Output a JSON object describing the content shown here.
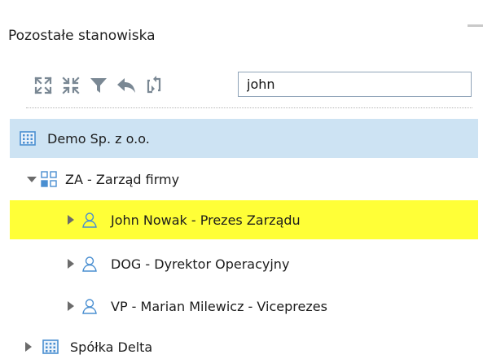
{
  "panel": {
    "title": "Pozostałe stanowiska"
  },
  "toolbar": {
    "buttons": [
      {
        "name": "expand-all",
        "icon": "expand-icon"
      },
      {
        "name": "collapse-all",
        "icon": "collapse-icon"
      },
      {
        "name": "filter",
        "icon": "filter-icon"
      },
      {
        "name": "back",
        "icon": "reply-arrow-icon"
      },
      {
        "name": "refresh",
        "icon": "refresh-icon"
      }
    ]
  },
  "search": {
    "value": "john",
    "placeholder": ""
  },
  "tree": {
    "items": [
      {
        "label": "Demo Sp. z o.o.",
        "icon": "building-icon",
        "state": "selected"
      },
      {
        "label": "ZA - Zarząd firmy",
        "icon": "org-unit-icon",
        "toggle": "expanded"
      },
      {
        "label": "John Nowak - Prezes Zarządu",
        "icon": "user-icon",
        "toggle": "collapsed",
        "state": "search-match"
      },
      {
        "label": "DOG - Dyrektor Operacyjny",
        "icon": "user-icon",
        "toggle": "collapsed"
      },
      {
        "label": "VP - Marian Milewicz - Viceprezes",
        "icon": "user-icon",
        "toggle": "collapsed"
      },
      {
        "label": "Spółka Delta",
        "icon": "building-icon",
        "toggle": "collapsed"
      }
    ]
  },
  "colors": {
    "selected_row": "#cde3f3",
    "match_highlight": "#ffff37",
    "icon_blue": "#4a8fd1",
    "toolbar_icon": "#7a8894"
  }
}
